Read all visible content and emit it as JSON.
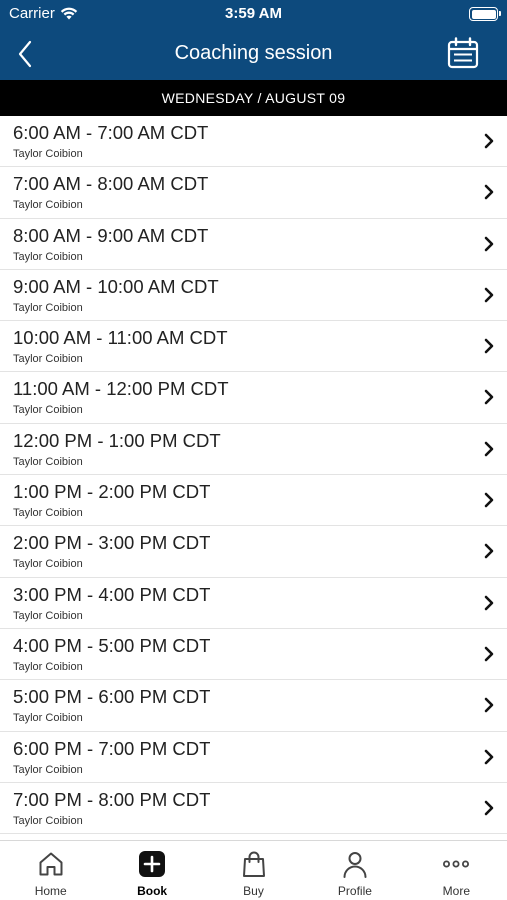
{
  "status_bar": {
    "carrier": "Carrier",
    "time": "3:59 AM"
  },
  "nav": {
    "title": "Coaching session",
    "back_icon": "chevron-left-icon",
    "calendar_icon": "calendar-icon"
  },
  "date_header": "WEDNESDAY / AUGUST 09",
  "sessions": [
    {
      "time": "6:00 AM - 7:00 AM CDT",
      "coach": "Taylor Coibion"
    },
    {
      "time": "7:00 AM - 8:00 AM CDT",
      "coach": "Taylor Coibion"
    },
    {
      "time": "8:00 AM - 9:00 AM CDT",
      "coach": "Taylor Coibion"
    },
    {
      "time": "9:00 AM - 10:00 AM CDT",
      "coach": "Taylor Coibion"
    },
    {
      "time": "10:00 AM - 11:00 AM CDT",
      "coach": "Taylor Coibion"
    },
    {
      "time": "11:00 AM - 12:00 PM CDT",
      "coach": "Taylor Coibion"
    },
    {
      "time": "12:00 PM - 1:00 PM CDT",
      "coach": "Taylor Coibion"
    },
    {
      "time": "1:00 PM - 2:00 PM CDT",
      "coach": "Taylor Coibion"
    },
    {
      "time": "2:00 PM - 3:00 PM CDT",
      "coach": "Taylor Coibion"
    },
    {
      "time": "3:00 PM - 4:00 PM CDT",
      "coach": "Taylor Coibion"
    },
    {
      "time": "4:00 PM - 5:00 PM CDT",
      "coach": "Taylor Coibion"
    },
    {
      "time": "5:00 PM - 6:00 PM CDT",
      "coach": "Taylor Coibion"
    },
    {
      "time": "6:00 PM - 7:00 PM CDT",
      "coach": "Taylor Coibion"
    },
    {
      "time": "7:00 PM - 8:00 PM CDT",
      "coach": "Taylor Coibion"
    }
  ],
  "tab_bar": {
    "tabs": [
      {
        "label": "Home",
        "icon": "home-icon",
        "active": false
      },
      {
        "label": "Book",
        "icon": "plus-square-icon",
        "active": true
      },
      {
        "label": "Buy",
        "icon": "shopping-bag-icon",
        "active": false
      },
      {
        "label": "Profile",
        "icon": "person-icon",
        "active": false
      },
      {
        "label": "More",
        "icon": "more-dots-icon",
        "active": false
      }
    ]
  },
  "colors": {
    "header_bg": "#0d4a7d",
    "date_bar_bg": "#000000",
    "row_divider": "#e3e3e3"
  }
}
